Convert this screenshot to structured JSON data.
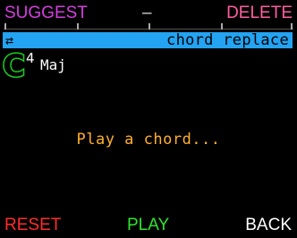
{
  "softkeys": {
    "top_left": {
      "label": "SUGGEST",
      "color": "#d63ee0"
    },
    "top_mid": {
      "label": "–",
      "color": "#d8d8d8"
    },
    "top_right": {
      "label": "DELETE",
      "color": "#ff5fa0"
    },
    "bottom_left": {
      "label": "RESET",
      "color": "#ff2c2c"
    },
    "bottom_mid": {
      "label": "PLAY",
      "color": "#2ce52c"
    },
    "bottom_right": {
      "label": "BACK",
      "color": "#ffffff"
    }
  },
  "mode_bar": {
    "icon": "cycle-icon",
    "icon_glyph": "⇄",
    "label": "chord replace",
    "color": "#23a3f2"
  },
  "chord": {
    "root": "C",
    "octave": "4",
    "quality": "Maj",
    "root_color": "#16d020"
  },
  "prompt": {
    "text": "Play a chord...",
    "color": "#ffb02e"
  }
}
